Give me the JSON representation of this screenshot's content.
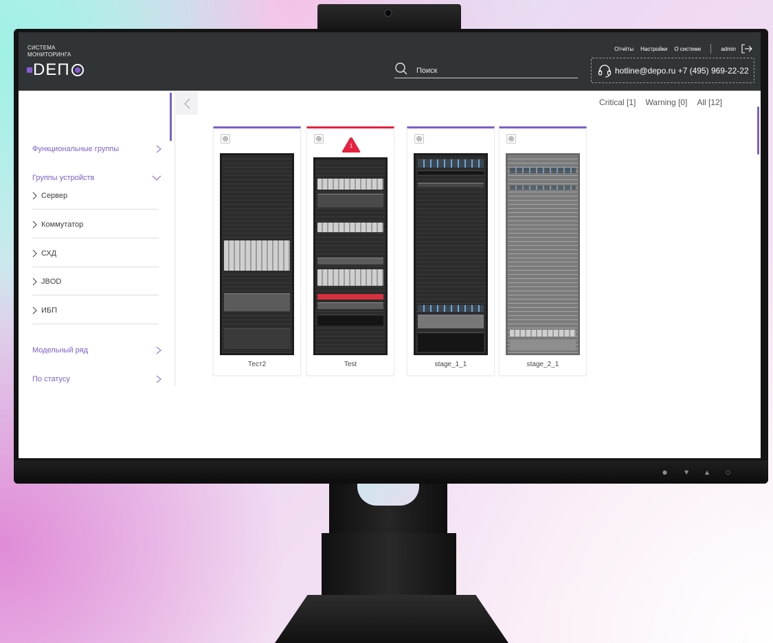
{
  "app": {
    "logo_small_line1": "СИСТЕМА",
    "logo_small_line2": "МОНИТОРИНГА",
    "logo_text": "DEП"
  },
  "search": {
    "placeholder": "Поиск",
    "value": ""
  },
  "topnav": {
    "reports": "Отчёты",
    "settings": "Настройки",
    "about": "О системе",
    "user": "admin"
  },
  "hotline": {
    "text": "hotline@depo.ru +7 (495) 969-22-22"
  },
  "sidebar": {
    "groups": [
      {
        "label": "Функциональные группы",
        "expanded": false
      },
      {
        "label": "Группы устройств",
        "expanded": true
      },
      {
        "label": "Модельный ряд",
        "expanded": false
      },
      {
        "label": "По статусу",
        "expanded": false
      }
    ],
    "device_types": [
      "Сервер",
      "Коммутатор",
      "СХД",
      "JBOD",
      "ИБП"
    ]
  },
  "filters": {
    "critical": "Critical [1]",
    "warning": "Warning [0]",
    "all": "All [12]"
  },
  "racks": [
    {
      "name": "Тест2",
      "status": "ok",
      "alerts": ""
    },
    {
      "name": "Test",
      "status": "critical",
      "alerts": "1"
    },
    {
      "name": "stage_1_1",
      "status": "ok",
      "alerts": ""
    },
    {
      "name": "stage_2_1",
      "status": "ok",
      "alerts": ""
    }
  ],
  "colors": {
    "accent": "#7b5fc7",
    "critical": "#e5213f",
    "topbar": "#303436"
  }
}
